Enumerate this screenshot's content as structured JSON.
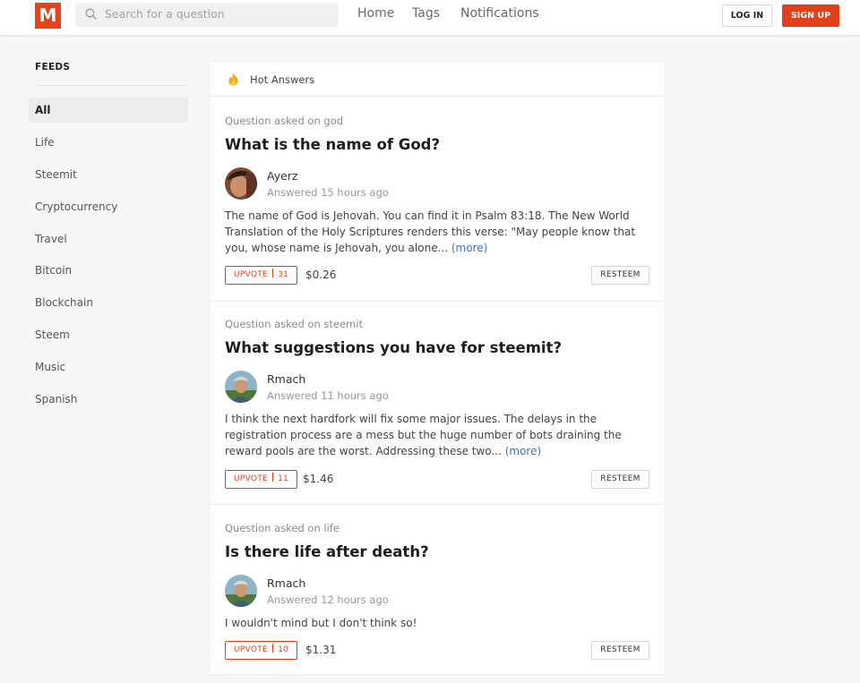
{
  "header": {
    "logo_letter": "M",
    "search_placeholder": "Search for a question",
    "nav": [
      "Home",
      "Tags",
      "Notifications"
    ],
    "login_label": "LOG IN",
    "signup_label": "SIGN UP",
    "colors": {
      "brand": "#e0401a"
    }
  },
  "sidebar": {
    "title": "FEEDS",
    "items": [
      "All",
      "Life",
      "Steemit",
      "Cryptocurrency",
      "Travel",
      "Bitcoin",
      "Blockchain",
      "Steem",
      "Music",
      "Spanish"
    ],
    "active": "All"
  },
  "main": {
    "section_title": "Hot Answers",
    "section_icon": "fire-icon",
    "cards": [
      {
        "meta": "Question asked on god",
        "title": "What is the name of God?",
        "author": "Ayerz",
        "answered": "Answered 15 hours ago",
        "answer": "The name of God is Jehovah. You can find it in Psalm 83:18. The New World Translation of the Holy Scriptures renders this verse: \"May people know that you, whose name is Jehovah, you alone...",
        "more": "(more)",
        "upvote_label": "UPVOTE",
        "upvote_count": "31",
        "payout": "$0.26",
        "resteem_label": "RESTEEM"
      },
      {
        "meta": "Question asked on steemit",
        "title": "What suggestions you have for steemit?",
        "author": "Rmach",
        "answered": "Answered 11 hours ago",
        "answer": "I think the next hardfork will fix some major issues. The delays in the registration process are a mess but the huge number of bots draining the reward pools are the worst. Addressing these two...",
        "more": "(more)",
        "upvote_label": "UPVOTE",
        "upvote_count": "11",
        "payout": "$1.46",
        "resteem_label": "RESTEEM"
      },
      {
        "meta": "Question asked on life",
        "title": "Is there life after death?",
        "author": "Rmach",
        "answered": "Answered 12 hours ago",
        "answer": "I wouldn't mind but I don't think so!",
        "more": "",
        "upvote_label": "UPVOTE",
        "upvote_count": "10",
        "payout": "$1.31",
        "resteem_label": "RESTEEM"
      }
    ]
  }
}
